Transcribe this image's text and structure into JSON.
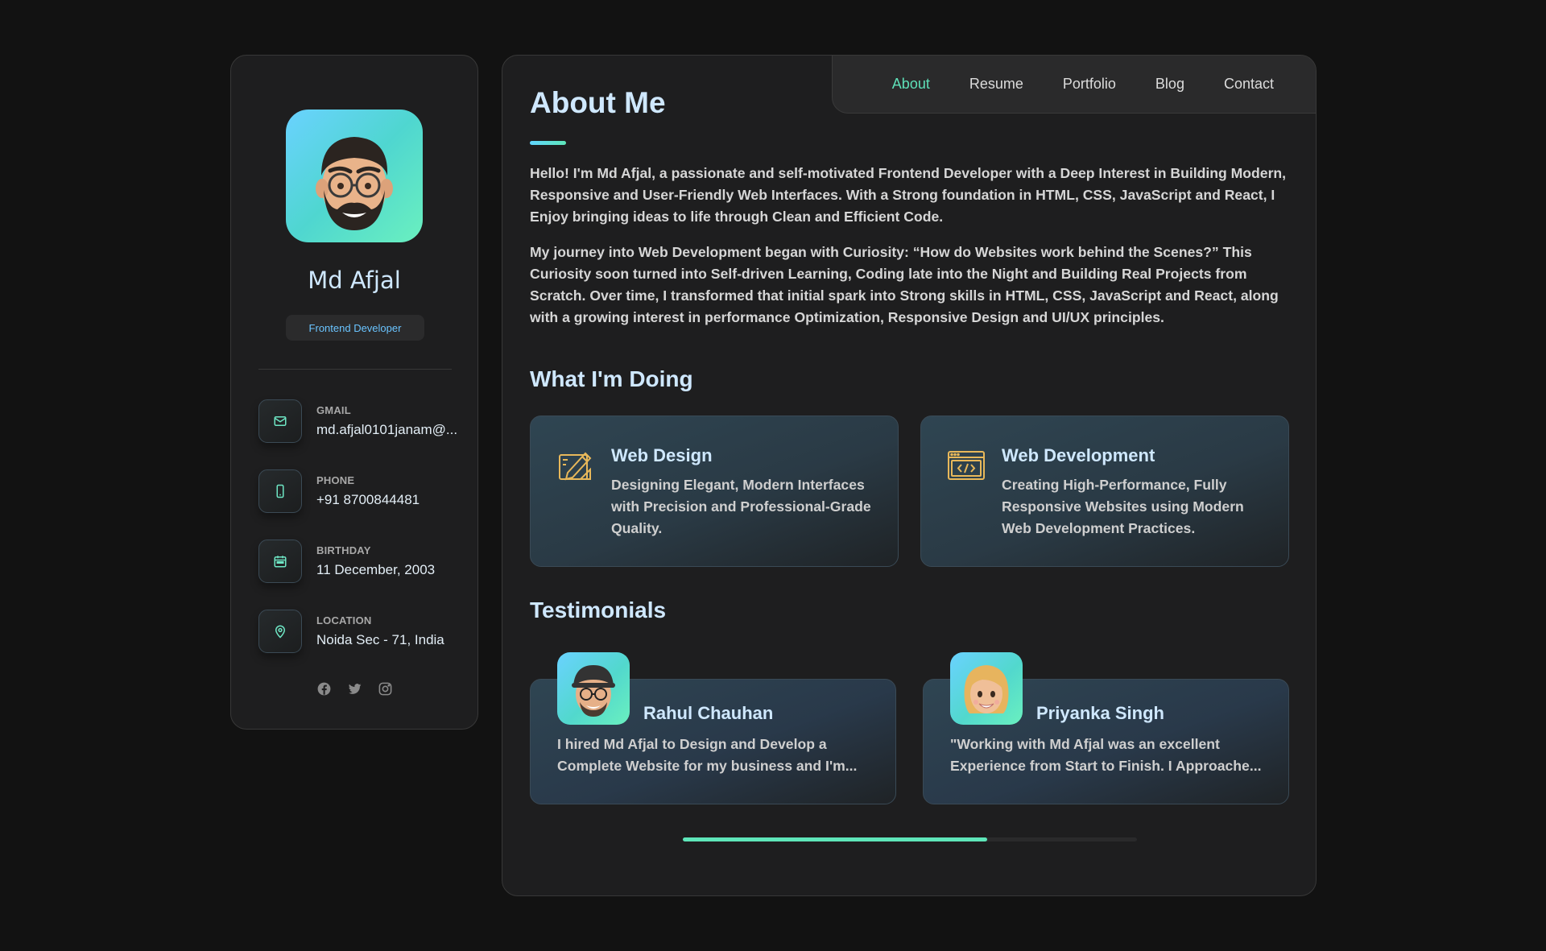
{
  "profile": {
    "name": "Md Afjal",
    "title": "Frontend Developer"
  },
  "contacts": [
    {
      "label": "GMAIL",
      "value": "md.afjal0101janam@...",
      "icon": "mail-icon"
    },
    {
      "label": "PHONE",
      "value": "+91 8700844481",
      "icon": "phone-icon"
    },
    {
      "label": "BIRTHDAY",
      "value": "11 December, 2003",
      "icon": "calendar-icon"
    },
    {
      "label": "LOCATION",
      "value": "Noida Sec - 71, India",
      "icon": "location-pin-icon"
    }
  ],
  "socials": [
    "facebook-icon",
    "twitter-icon",
    "instagram-icon"
  ],
  "nav": {
    "items": [
      "About",
      "Resume",
      "Portfolio",
      "Blog",
      "Contact"
    ],
    "active": "About"
  },
  "about": {
    "title": "About Me",
    "paragraphs": [
      "Hello! I'm Md Afjal, a passionate and self-motivated Frontend Developer with a Deep Interest in Building Modern, Responsive and User-Friendly Web Interfaces. With a Strong foundation in HTML, CSS, JavaScript and React, I Enjoy bringing ideas to life through Clean and Efficient Code.",
      "My journey into Web Development began with Curiosity: “How do Websites work behind the Scenes?” This Curiosity soon turned into Self-driven Learning, Coding late into the Night and Building Real Projects from Scratch. Over time, I transformed that initial spark into Strong skills in HTML, CSS, JavaScript and React, along with a growing interest in performance Optimization, Responsive Design and UI/UX principles."
    ]
  },
  "services": {
    "title": "What I'm Doing",
    "items": [
      {
        "title": "Web Design",
        "text": "Designing Elegant, Modern Interfaces with Precision and Professional-Grade Quality.",
        "icon": "design-pencil-icon"
      },
      {
        "title": "Web Development",
        "text": "Creating High-Performance, Fully Responsive Websites using Modern Web Development Practices.",
        "icon": "code-window-icon"
      }
    ]
  },
  "testimonials": {
    "title": "Testimonials",
    "items": [
      {
        "name": "Rahul Chauhan",
        "text": "I hired Md Afjal to Design and Develop a Complete Website for my business and I'm..."
      },
      {
        "name": "Priyanka Singh",
        "text": "\"Working with Md Afjal was an excellent Experience from Start to Finish. I Approache..."
      }
    ],
    "scroll_progress": 0.67
  },
  "colors": {
    "accent": "#5ee6b9",
    "heading": "#cfe8ff",
    "icon_gold": "#e8b85a"
  }
}
